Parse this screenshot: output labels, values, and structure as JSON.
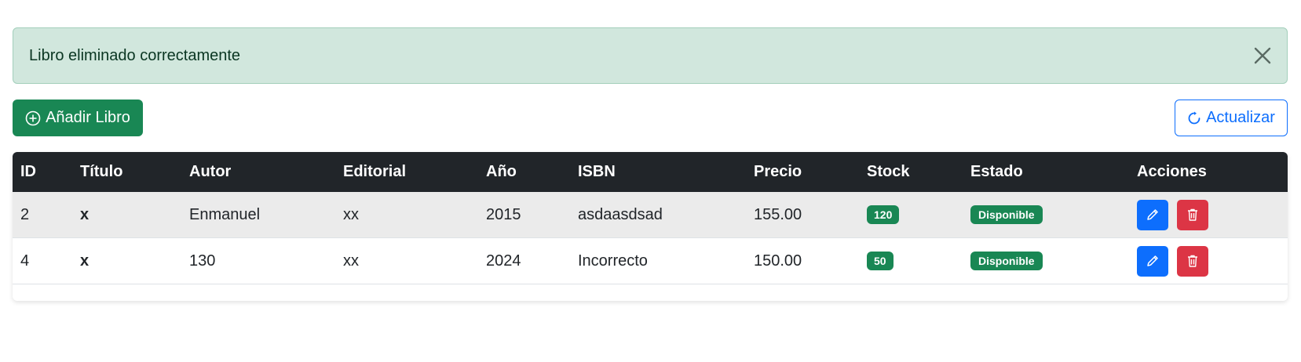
{
  "alert": {
    "message": "Libro eliminado correctamente",
    "close_icon": "close-icon"
  },
  "toolbar": {
    "add_label": "Añadir Libro",
    "add_icon": "plus-circle-icon",
    "refresh_label": "Actualizar",
    "refresh_icon": "refresh-icon"
  },
  "table": {
    "headers": [
      "ID",
      "Título",
      "Autor",
      "Editorial",
      "Año",
      "ISBN",
      "Precio",
      "Stock",
      "Estado",
      "Acciones"
    ],
    "rows": [
      {
        "id": "2",
        "titulo": "x",
        "autor": "Enmanuel",
        "editorial": "xx",
        "anio": "2015",
        "isbn": "asdaasdsad",
        "precio": "155.00",
        "stock": "120",
        "estado": "Disponible"
      },
      {
        "id": "4",
        "titulo": "x",
        "autor": "130",
        "editorial": "xx",
        "anio": "2024",
        "isbn": "Incorrecto",
        "precio": "150.00",
        "stock": "50",
        "estado": "Disponible"
      }
    ]
  },
  "colors": {
    "success": "#198754",
    "primary": "#0d6efd",
    "danger": "#dc3545",
    "header_bg": "#212529",
    "alert_bg": "#d1e7dd"
  }
}
